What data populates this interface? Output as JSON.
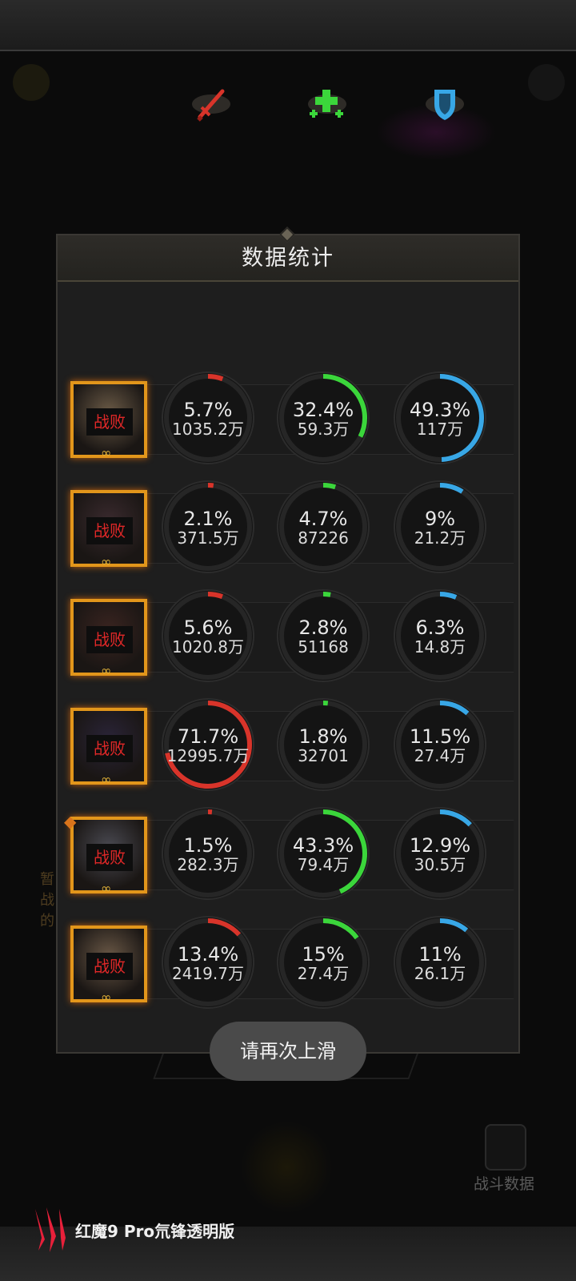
{
  "panel": {
    "title": "数据统计"
  },
  "columns": [
    {
      "icon": "sword-icon",
      "color": "#d8342a"
    },
    {
      "icon": "heal-cross-icon",
      "color": "#3bd63b"
    },
    {
      "icon": "shield-icon",
      "color": "#38a7e6"
    }
  ],
  "heroes": [
    {
      "status": "战败",
      "stats": [
        {
          "pct_label": "5.7%",
          "value": "1035.2万",
          "fraction": 0.057
        },
        {
          "pct_label": "32.4%",
          "value": "59.3万",
          "fraction": 0.324
        },
        {
          "pct_label": "49.3%",
          "value": "117万",
          "fraction": 0.493
        }
      ]
    },
    {
      "status": "战败",
      "stats": [
        {
          "pct_label": "2.1%",
          "value": "371.5万",
          "fraction": 0.021
        },
        {
          "pct_label": "4.7%",
          "value": "87226",
          "fraction": 0.047
        },
        {
          "pct_label": "9%",
          "value": "21.2万",
          "fraction": 0.09
        }
      ]
    },
    {
      "status": "战败",
      "stats": [
        {
          "pct_label": "5.6%",
          "value": "1020.8万",
          "fraction": 0.056
        },
        {
          "pct_label": "2.8%",
          "value": "51168",
          "fraction": 0.028
        },
        {
          "pct_label": "6.3%",
          "value": "14.8万",
          "fraction": 0.063
        }
      ]
    },
    {
      "status": "战败",
      "stats": [
        {
          "pct_label": "71.7%",
          "value": "12995.7万",
          "fraction": 0.717
        },
        {
          "pct_label": "1.8%",
          "value": "32701",
          "fraction": 0.018
        },
        {
          "pct_label": "11.5%",
          "value": "27.4万",
          "fraction": 0.115
        }
      ]
    },
    {
      "status": "战败",
      "stats": [
        {
          "pct_label": "1.5%",
          "value": "282.3万",
          "fraction": 0.015
        },
        {
          "pct_label": "43.3%",
          "value": "79.4万",
          "fraction": 0.433
        },
        {
          "pct_label": "12.9%",
          "value": "30.5万",
          "fraction": 0.129
        }
      ]
    },
    {
      "status": "战败",
      "stats": [
        {
          "pct_label": "13.4%",
          "value": "2419.7万",
          "fraction": 0.134
        },
        {
          "pct_label": "15%",
          "value": "27.4万",
          "fraction": 0.15
        },
        {
          "pct_label": "11%",
          "value": "26.1万",
          "fraction": 0.11
        }
      ]
    }
  ],
  "toast": {
    "text": "请再次上滑"
  },
  "background": {
    "stats_button_label": "战斗数据"
  },
  "device_watermark": {
    "text": "红魔9 Pro氘锋透明版"
  }
}
